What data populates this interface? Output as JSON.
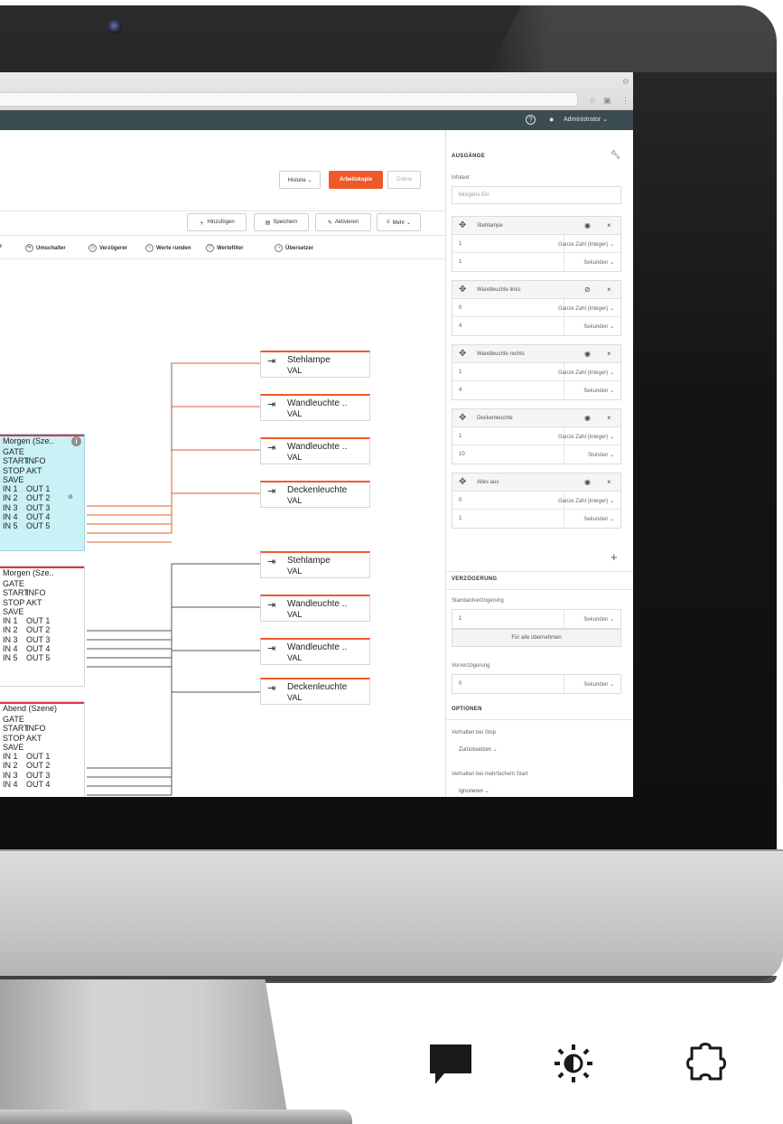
{
  "topbar": {
    "historie": "Historie ⌄",
    "arbeitskopie": "Arbeitskopie",
    "online": "Online",
    "add": "Hinzufügen",
    "save": "Speichern",
    "activate": "Aktivieren",
    "more": "Mehr ⌄"
  },
  "header": {
    "user": "Administrator ⌄"
  },
  "palette": [
    {
      "icon": "switch-icon",
      "label": "Umschalter"
    },
    {
      "icon": "delay-icon",
      "label": "Verzögerer"
    },
    {
      "icon": "round-icon",
      "label": "Werte runden"
    },
    {
      "icon": "filter-icon",
      "label": "Wertefilter"
    },
    {
      "icon": "translator-icon",
      "label": "Übersetzer"
    }
  ],
  "palette_partial": "r",
  "blocks": [
    {
      "title": "Morgen (Sze..",
      "rows": [
        [
          "GATE",
          ""
        ],
        [
          "START",
          "INFO"
        ],
        [
          "STOP",
          "AKT"
        ],
        [
          "SAVE",
          ""
        ],
        [
          "IN 1",
          "OUT 1"
        ],
        [
          "IN 2",
          "OUT 2"
        ],
        [
          "IN 3",
          "OUT 3"
        ],
        [
          "IN 4",
          "OUT 4"
        ],
        [
          "IN 5",
          "OUT 5"
        ]
      ]
    },
    {
      "title": "Morgen (Sze..",
      "rows": [
        [
          "GATE",
          ""
        ],
        [
          "START",
          "INFO"
        ],
        [
          "STOP",
          "AKT"
        ],
        [
          "SAVE",
          ""
        ],
        [
          "IN 1",
          "OUT 1"
        ],
        [
          "IN 2",
          "OUT 2"
        ],
        [
          "IN 3",
          "OUT 3"
        ],
        [
          "IN 4",
          "OUT 4"
        ],
        [
          "IN 5",
          "OUT 5"
        ]
      ]
    },
    {
      "title": "Abend (Szene)",
      "rows": [
        [
          "GATE",
          ""
        ],
        [
          "START",
          "INFO"
        ],
        [
          "STOP",
          "AKT"
        ],
        [
          "SAVE",
          ""
        ],
        [
          "IN 1",
          "OUT 1"
        ],
        [
          "IN 2",
          "OUT 2"
        ],
        [
          "IN 3",
          "OUT 3"
        ],
        [
          "IN 4",
          "OUT 4"
        ]
      ]
    }
  ],
  "outputs": [
    {
      "name": "Stehlampe",
      "val": "VAL"
    },
    {
      "name": "Wandleuchte ..",
      "val": "VAL"
    },
    {
      "name": "Wandleuchte ..",
      "val": "VAL"
    },
    {
      "name": "Deckenleuchte",
      "val": "VAL"
    },
    {
      "name": "Stehlampe",
      "val": "VAL"
    },
    {
      "name": "Wandleuchte ..",
      "val": "VAL"
    },
    {
      "name": "Wandleuchte ..",
      "val": "VAL"
    },
    {
      "name": "Deckenleuchte",
      "val": "VAL"
    }
  ],
  "panel": {
    "section_outputs": "AUSGÄNGE",
    "infotext_label": "Infotext",
    "infotext_value": "Morgens Ein",
    "items": [
      {
        "name": "Stehlampe",
        "visible": true,
        "value": "1",
        "type": "Ganze Zahl (Integer) ⌄",
        "time": "1",
        "unit": "Sekunden ⌄"
      },
      {
        "name": "Wandleuchte links",
        "visible": false,
        "value": "0",
        "type": "Ganze Zahl (Integer) ⌄",
        "time": "4",
        "unit": "Sekunden ⌄"
      },
      {
        "name": "Wandleuchte rechts",
        "visible": true,
        "value": "1",
        "type": "Ganze Zahl (Integer) ⌄",
        "time": "4",
        "unit": "Sekunden ⌄"
      },
      {
        "name": "Deckenleuchte",
        "visible": true,
        "value": "1",
        "type": "Ganze Zahl (Integer) ⌄",
        "time": "10",
        "unit": "Stunden ⌄"
      },
      {
        "name": "Alles aus",
        "visible": true,
        "value": "0",
        "type": "Ganze Zahl (Integer) ⌄",
        "time": "1",
        "unit": "Sekunden ⌄"
      }
    ],
    "section_delay": "VERZÖGERUNG",
    "std_delay_label": "Standardverzögerung",
    "std_delay_value": "1",
    "std_delay_unit": "Sekunden ⌄",
    "apply_all": "Für alle übernehmen",
    "pre_delay_label": "Vorverzögerung",
    "pre_delay_value": "0",
    "pre_delay_unit": "Sekunden ⌄",
    "section_options": "OPTIONEN",
    "stop_label": "Verhalten bei Stop",
    "stop_value": "Zurücksetzen ⌄",
    "multi_label": "Verhalten bei mehrfachem Start",
    "multi_value": "Ignorieren ⌄"
  },
  "colors": {
    "accent": "#ee5a2a",
    "header": "#3c4c53",
    "block_active": "#c9f1f6",
    "block_border_top": "#e0334d"
  }
}
